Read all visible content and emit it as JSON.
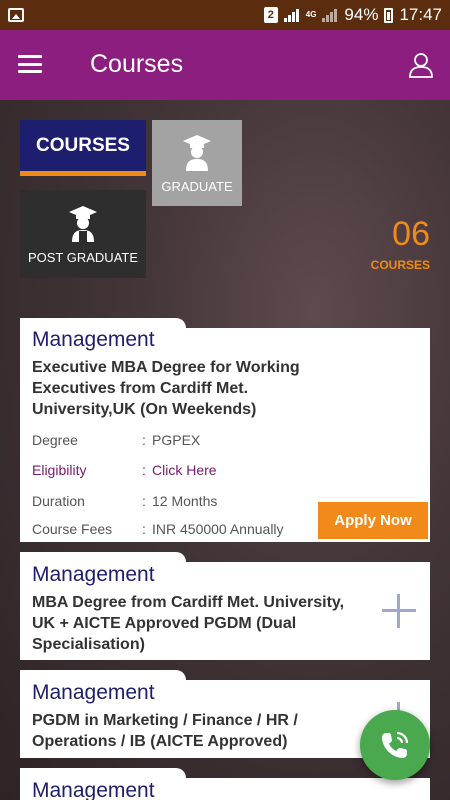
{
  "status_bar": {
    "sim": "2",
    "network": "4G",
    "battery": "94%",
    "time": "17:47"
  },
  "app_bar": {
    "title": "Courses",
    "menu_icon": "menu-icon",
    "profile_icon": "user-icon",
    "color": "#8c1e7f"
  },
  "filters": {
    "courses": "COURSES",
    "graduate": "GRADUATE",
    "post_graduate": "POST GRADUATE"
  },
  "count": {
    "number": "06",
    "label": "COURSES"
  },
  "cards": [
    {
      "category": "Management",
      "title": "Executive MBA Degree for Working Executives from Cardiff Met. University,UK (On Weekends)",
      "title_lines": [
        "Executive MBA Degree for Working",
        "Executives from Cardiff Met.",
        "University,UK (On Weekends)"
      ],
      "details": {
        "degree_label": "Degree",
        "degree_value": "PGPEX",
        "eligibility_label": "Eligibility",
        "eligibility_value": "Click Here",
        "duration_label": "Duration",
        "duration_value": "12 Months",
        "fees_label": "Course Fees",
        "fees_value": "INR 450000 Annually"
      },
      "action": "Apply Now"
    },
    {
      "category": "Management",
      "title_lines": [
        "MBA Degree from Cardiff Met. University,",
        "UK + AICTE Approved PGDM (Dual",
        "Specialisation)"
      ]
    },
    {
      "category": "Management",
      "title_lines": [
        "PGDM in Marketing / Finance / HR /",
        "Operations / IB (AICTE Approved)"
      ]
    },
    {
      "category": "Management"
    }
  ],
  "accent_color": "#f28a1a",
  "fab_icon": "phone-call-icon"
}
